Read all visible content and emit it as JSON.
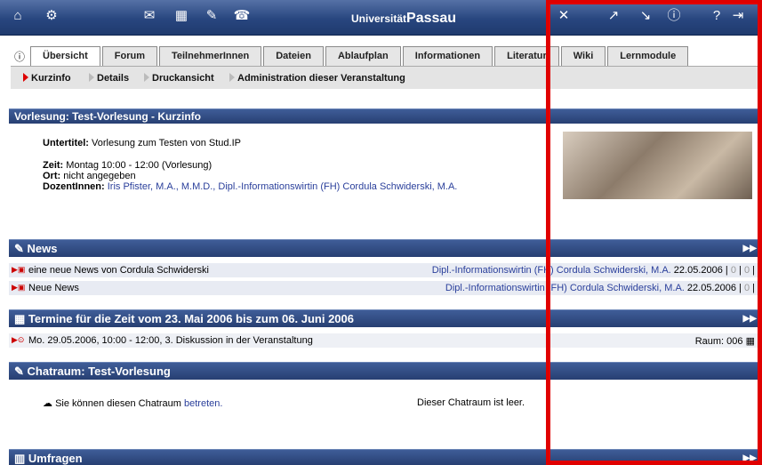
{
  "header": {
    "logo_small": "Universität",
    "logo_big": "Passau",
    "left_icons": [
      "home-icon",
      "settings-icon",
      "mail-icon",
      "calendar-icon",
      "chat-icon",
      "messenger-icon"
    ],
    "right_icons": [
      "tools-icon",
      "edit-icon",
      "search-icon",
      "info-icon",
      "help-icon",
      "logout-icon"
    ]
  },
  "tabs": [
    {
      "label": "Übersicht",
      "active": true
    },
    {
      "label": "Forum"
    },
    {
      "label": "TeilnehmerInnen"
    },
    {
      "label": "Dateien"
    },
    {
      "label": "Ablaufplan"
    },
    {
      "label": "Informationen"
    },
    {
      "label": "Literatur"
    },
    {
      "label": "Wiki"
    },
    {
      "label": "Lernmodule"
    }
  ],
  "subnav": [
    "Kurzinfo",
    "Details",
    "Druckansicht",
    "Administration dieser Veranstaltung"
  ],
  "kurzinfo": {
    "title": "Vorlesung: Test-Vorlesung - Kurzinfo",
    "untertitel_label": "Untertitel:",
    "untertitel_value": "Vorlesung zum Testen von Stud.IP",
    "zeit_label": "Zeit:",
    "zeit_value": "Montag 10:00 - 12:00 (Vorlesung)",
    "ort_label": "Ort:",
    "ort_value": "nicht angegeben",
    "dozent_label": "DozentInnen:",
    "dozent_value": "Iris Pfister, M.A., M.M.D., Dipl.-Informationswirtin (FH) Cordula Schwiderski, M.A."
  },
  "news": {
    "title": "News",
    "items": [
      {
        "title": "eine neue News von Cordula Schwiderski",
        "author": "Dipl.-Informationswirtin (FH) Cordula Schwiderski, M.A.",
        "date": "22.05.2006",
        "c1": "0",
        "c2": "0"
      },
      {
        "title": "Neue News",
        "author": "Dipl.-Informationswirtin (FH) Cordula Schwiderski, M.A.",
        "date": "22.05.2006",
        "c1": "0"
      }
    ]
  },
  "termine": {
    "title": "Termine für die Zeit vom 23. Mai 2006 bis zum 06. Juni 2006",
    "item": "Mo. 29.05.2006, 10:00 - 12:00, 3. Diskussion in der Veranstaltung",
    "raum": "Raum: 006"
  },
  "chat": {
    "title": "Chatraum: Test-Vorlesung",
    "text": "Sie können diesen Chatraum",
    "link": "betreten.",
    "status": "Dieser Chatraum ist leer."
  },
  "umfragen": {
    "title": "Umfragen"
  }
}
